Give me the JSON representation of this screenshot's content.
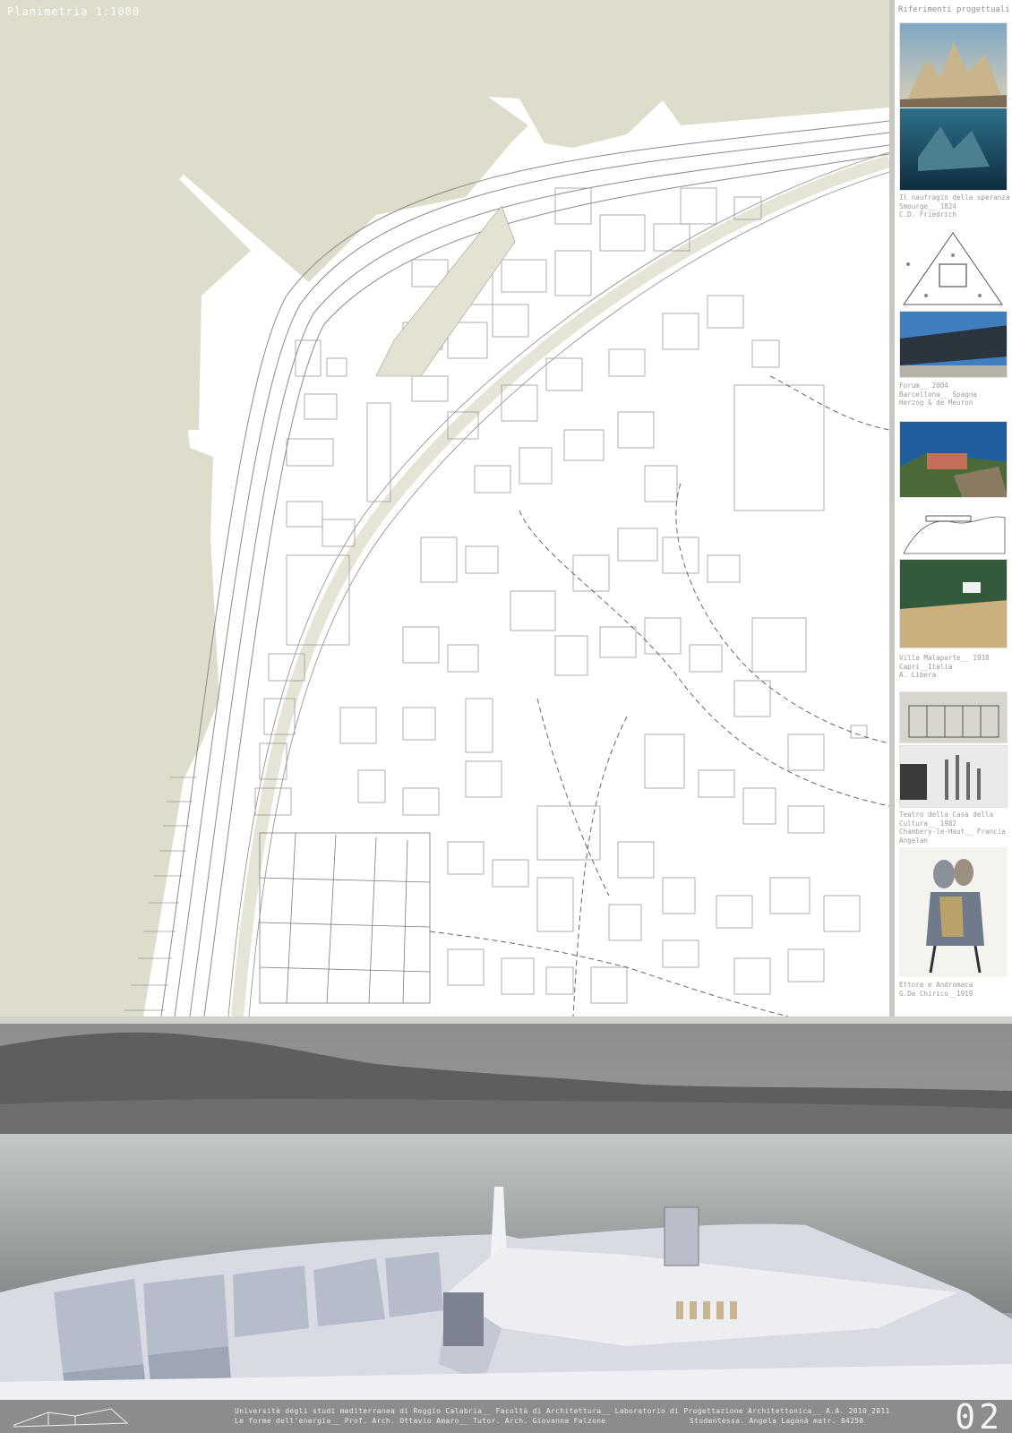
{
  "plan": {
    "title": "Planimetria 1:1000"
  },
  "sidebar": {
    "title": "Riferimenti progettuali",
    "references": [
      {
        "caption": "Il naufragio della speranza\nSmourge__ 1824\nC.D. Friedrich",
        "image": "seascape-painting"
      },
      {
        "caption": "Forum__ 2004\nBarcellona__ Spagna\nHerzog & de Meuron",
        "image": "forum-building-photo"
      },
      {
        "caption": "Villa Malaparte__ 1938\nCapri__Italia\nA. Libera",
        "image": "villa-malaparte-photo"
      },
      {
        "caption": "Teatro della Casa della\nCultura__ 1982\nChambery-le-Haut__ Francia\nAngelan",
        "image": "theatre-photo"
      },
      {
        "caption": "Ettore e Andromaca\nG.De Chirico__1919",
        "image": "de-chirico-painting"
      }
    ]
  },
  "render": {
    "image": "aerial-render-of-project"
  },
  "footer": {
    "line1": "Università degli studi mediterranea di Reggio Calabria__ Facoltà di Architettura__ Laboratorio di Progettazione Architettonica__  A.A. 2010_2011",
    "line2_left": "Le forme dell'energia__ Prof. Arch. Ottavio Amaro__ Tutor. Arch. Giovanna Falzone",
    "line2_right": "Studentessa. Angela Laganà  matr. 84250",
    "page_number": "02"
  },
  "colors": {
    "sea": "#dedcca",
    "land": "#ffffff",
    "footer": "#8c8c8c"
  }
}
